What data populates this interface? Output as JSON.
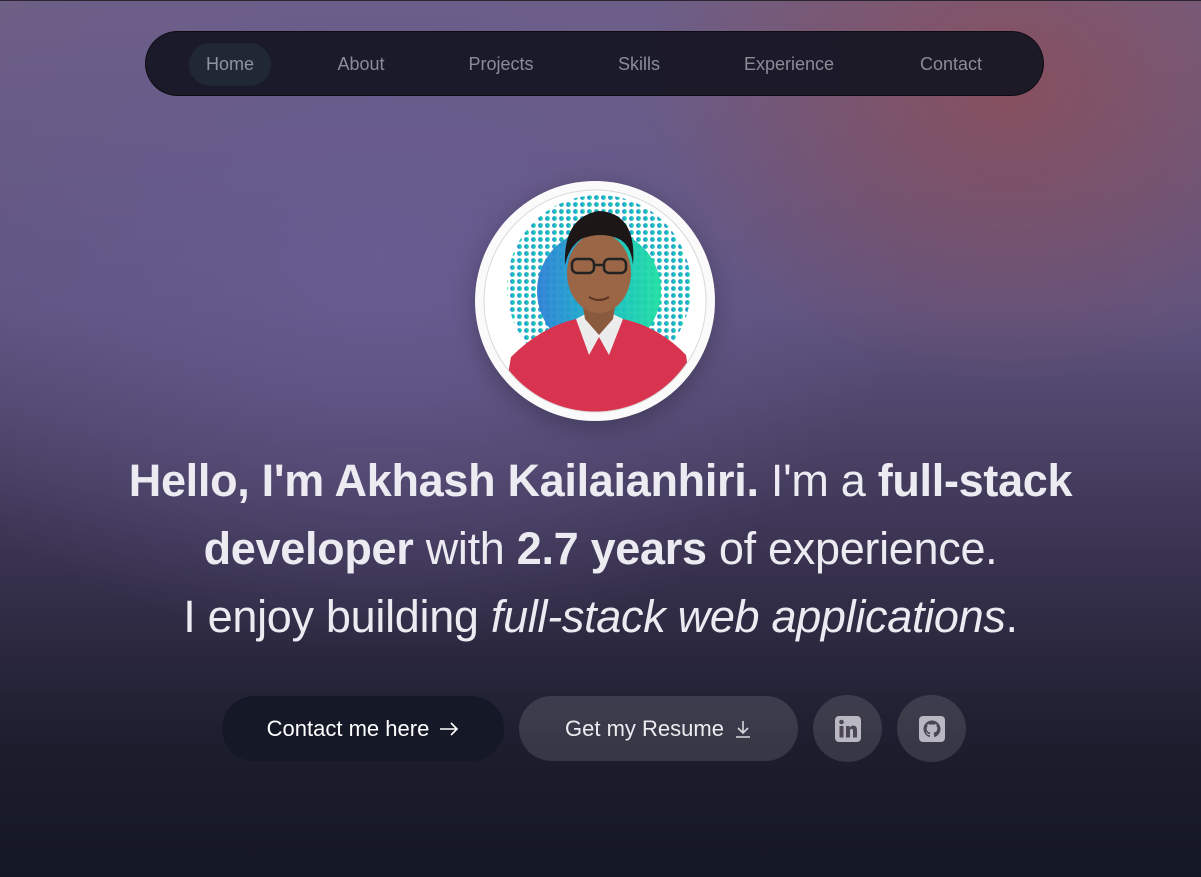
{
  "nav": {
    "items": [
      {
        "label": "Home",
        "active": true
      },
      {
        "label": "About"
      },
      {
        "label": "Projects"
      },
      {
        "label": "Skills"
      },
      {
        "label": "Experience"
      },
      {
        "label": "Contact"
      }
    ]
  },
  "hero": {
    "intro": {
      "hello": "Hello, I'm Akhash Kailaianhiri.",
      "im_a": "I'm a",
      "role": "full-stack developer",
      "with": "with",
      "years": "2.7 years",
      "of_exp": "of experience.",
      "enjoy": "I enjoy building",
      "focus": "full-stack web applications",
      "period": "."
    },
    "avatar_icon": "profile-photo"
  },
  "actions": {
    "contact_label": "Contact me here",
    "contact_icon": "arrow-right-icon",
    "resume_label": "Get my Resume",
    "resume_icon": "download-icon",
    "linkedin_icon": "linkedin-icon",
    "github_icon": "github-icon"
  },
  "colors": {
    "dark_button": "#141827",
    "glass_button": "rgba(255,255,255,0.12)",
    "nav_bg": "#16161f",
    "text": "#ecebf1"
  }
}
